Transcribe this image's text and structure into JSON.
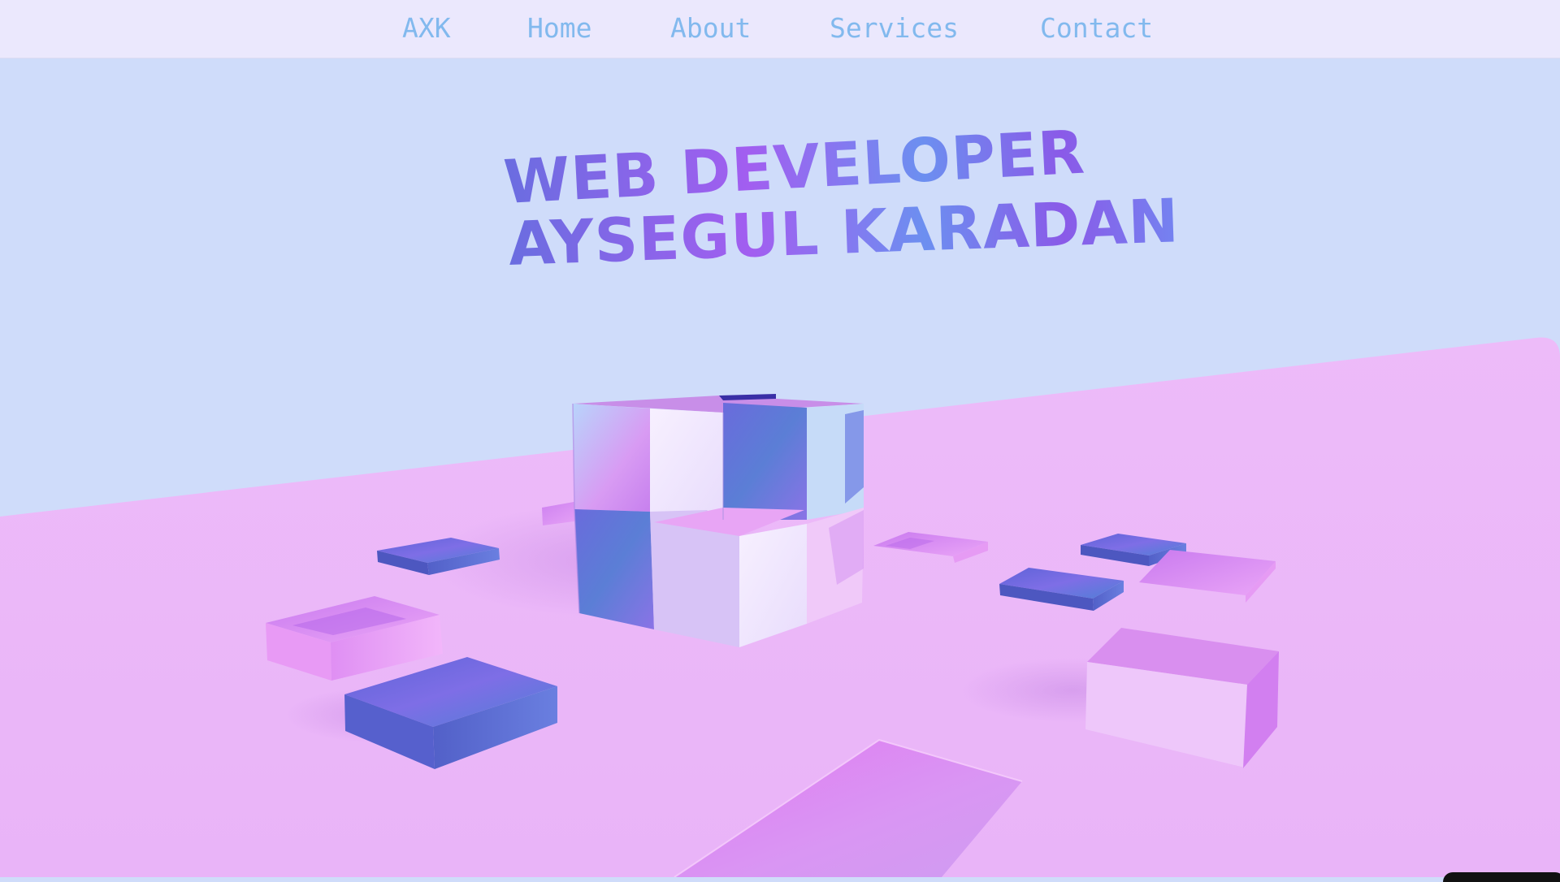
{
  "navbar": {
    "brand": "AXK",
    "links": [
      "Home",
      "About",
      "Services",
      "Contact"
    ]
  },
  "hero": {
    "line1": "WEB DEVELOPER",
    "line2": "AYSEGUL KARADAN"
  },
  "colors": {
    "sky": "#cfdcfa",
    "floor": "#ecb8fa",
    "nav_background": "#ebe8fd",
    "nav_text": "#82b9ee",
    "accent_purple": "#a25ef0",
    "accent_blue": "#6a6de0"
  }
}
